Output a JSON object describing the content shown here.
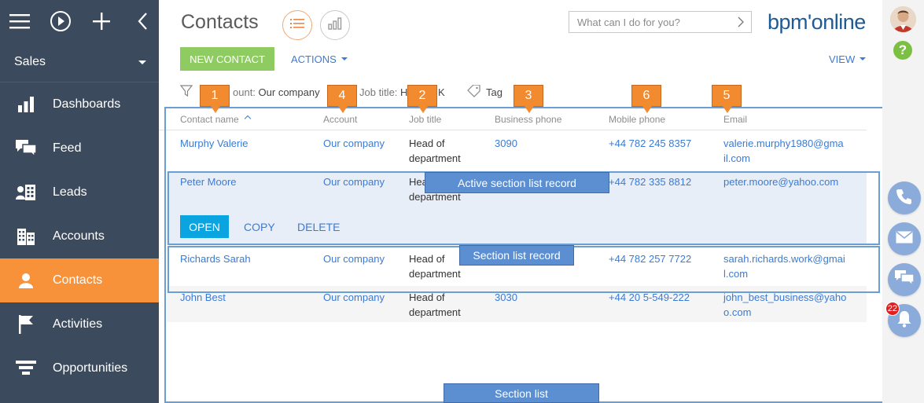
{
  "workspace": "Sales",
  "nav": [
    {
      "label": "Dashboards",
      "icon": "dashboard-icon"
    },
    {
      "label": "Feed",
      "icon": "feed-icon"
    },
    {
      "label": "Leads",
      "icon": "leads-icon"
    },
    {
      "label": "Accounts",
      "icon": "accounts-icon"
    },
    {
      "label": "Contacts",
      "icon": "contacts-icon",
      "active": true
    },
    {
      "label": "Activities",
      "icon": "flag-icon"
    },
    {
      "label": "Opportunities",
      "icon": "funnel-icon"
    }
  ],
  "page": {
    "title": "Contacts",
    "command_placeholder": "What can I do for you?",
    "logo": "bpm'online"
  },
  "toolbar": {
    "new_label": "NEW CONTACT",
    "actions_label": "ACTIONS",
    "view_label": "VIEW"
  },
  "filters": {
    "account_label": "ount:",
    "account_value": "Our company",
    "job_label": "Job title:",
    "job_value": "H",
    "job_value_tail": "K",
    "tag_label": "Tag"
  },
  "columns": [
    "Contact name",
    "Account",
    "Job title",
    "Business phone",
    "Mobile phone",
    "Email"
  ],
  "rows": [
    {
      "name": "Murphy Valerie",
      "account": "Our company",
      "job1": "Head of",
      "job2": "department",
      "bphone": "3090",
      "mphone": "+44 782 245 8357",
      "email1": "valerie.murphy1980@gma",
      "email2": "il.com"
    },
    {
      "name": "Peter Moore",
      "account": "Our company",
      "job1": "Hea",
      "job2": "department",
      "bphone": "",
      "mphone": "+44 782 335 8812",
      "email1": "peter.moore@yahoo.com",
      "email2": ""
    },
    {
      "name": "Richards Sarah",
      "account": "Our company",
      "job1": "Head of",
      "job2": "department",
      "bphone": "",
      "mphone": "+44 782 257 7722",
      "email1": "sarah.richards.work@gmai",
      "email2": "l.com"
    },
    {
      "name": "John Best",
      "account": "Our company",
      "job1": "Head of",
      "job2": "department",
      "bphone": "3030",
      "mphone": "+44 20 5-549-222",
      "email1": "john_best_business@yaho",
      "email2": "o.com"
    }
  ],
  "row_actions": {
    "open": "OPEN",
    "copy": "COPY",
    "delete": "DELETE"
  },
  "annotations": {
    "active_record": "Active section list record",
    "record": "Section list record",
    "section_list": "Section list",
    "markers": [
      "1",
      "4",
      "2",
      "3",
      "6",
      "5"
    ]
  },
  "notifications_count": "22",
  "colors": {
    "sidebar": "#3c4a5e",
    "active_nav": "#f7923a",
    "new_button": "#8ecb60",
    "open_button": "#0aa4e0",
    "link": "#3a7bd5",
    "annotation_blue": "#5b8fd1",
    "annotation_orange": "#f28a30"
  }
}
